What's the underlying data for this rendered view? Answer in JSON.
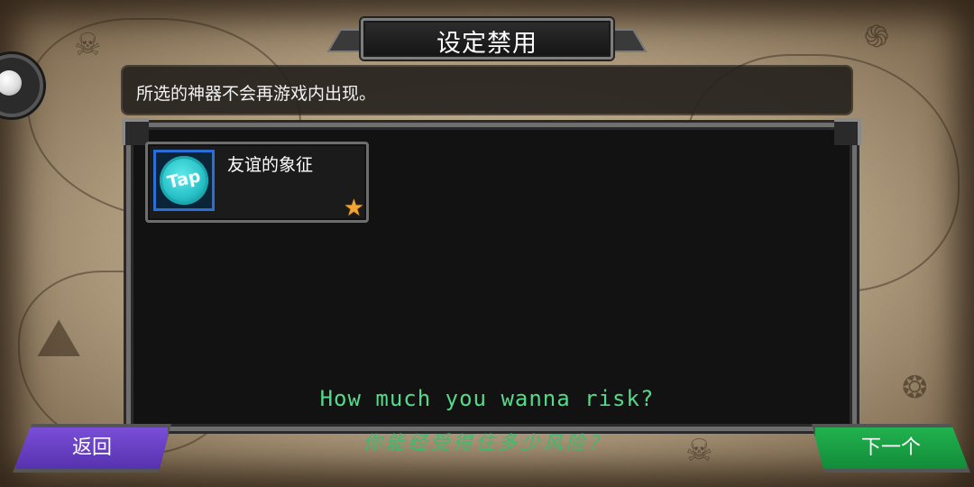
{
  "header": {
    "title": "设定禁用"
  },
  "description": "所选的神器不会再游戏内出现。",
  "artifacts": [
    {
      "name": "友谊的象征",
      "icon_label": "Tap",
      "icon": "tap-coin-icon",
      "rarity_icon": "star-icon"
    }
  ],
  "risk": {
    "english": "How much you wanna risk?",
    "chinese": "你能经受得住多少风险？"
  },
  "buttons": {
    "back_label": "返回",
    "next_label": "下一个"
  },
  "colors": {
    "back_button": "#6a40c8",
    "next_button": "#1aa046",
    "risk_text": "#56d98b",
    "icon_border": "#2b6ed8",
    "star": "#f3a531"
  }
}
